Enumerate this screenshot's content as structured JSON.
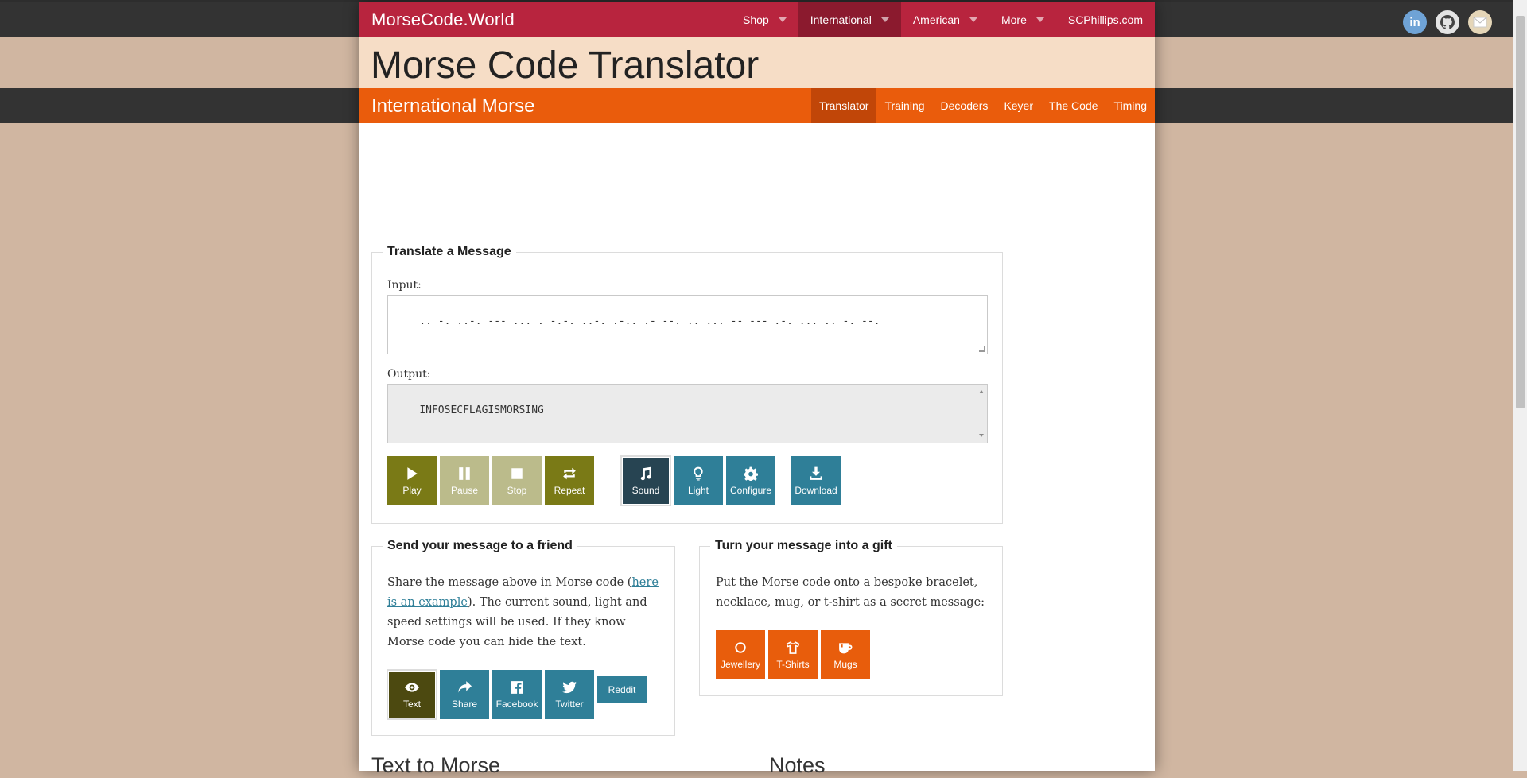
{
  "site": {
    "brand": "MorseCode.World",
    "nav": [
      {
        "label": "Shop",
        "dropdown": true,
        "active": false
      },
      {
        "label": "International",
        "dropdown": true,
        "active": true
      },
      {
        "label": "American",
        "dropdown": true,
        "active": false
      },
      {
        "label": "More",
        "dropdown": true,
        "active": false
      },
      {
        "label": "SCPhillips.com",
        "dropdown": false,
        "active": false
      }
    ],
    "social_icons": [
      "linkedin-icon",
      "github-icon",
      "mail-icon"
    ]
  },
  "page": {
    "title": "Morse Code Translator",
    "subtitle": "International Morse",
    "subnav": [
      "Translator",
      "Training",
      "Decoders",
      "Keyer",
      "The Code",
      "Timing"
    ],
    "active_subnav": "Translator"
  },
  "translate": {
    "legend": "Translate a Message",
    "input_label": "Input:",
    "input_value": ".. -. ..-. --- ... . -.-. ..-. .-.. .- --. .. ... -- --- .-. ... .. -. --.",
    "output_label": "Output:",
    "output_value": "INFOSECFLAGISMORSING",
    "buttons": [
      {
        "label": "Play",
        "icon": "play-icon"
      },
      {
        "label": "Pause",
        "icon": "pause-icon"
      },
      {
        "label": "Stop",
        "icon": "stop-icon"
      },
      {
        "label": "Repeat",
        "icon": "repeat-icon"
      },
      {
        "label": "Sound",
        "icon": "music-icon"
      },
      {
        "label": "Light",
        "icon": "lightbulb-icon"
      },
      {
        "label": "Configure",
        "icon": "gear-icon"
      },
      {
        "label": "Download",
        "icon": "download-icon"
      }
    ]
  },
  "send": {
    "legend": "Send your message to a friend",
    "text_before": "Share the message above in Morse code (",
    "link": "here is an example",
    "text_after": "). The current sound, light and speed settings will be used. If they know Morse code you can hide the text.",
    "buttons": [
      {
        "label": "Text",
        "icon": "eye-icon"
      },
      {
        "label": "Share",
        "icon": "share-icon"
      },
      {
        "label": "Facebook",
        "icon": "facebook-icon"
      },
      {
        "label": "Twitter",
        "icon": "twitter-icon"
      },
      {
        "label": "Reddit"
      }
    ]
  },
  "gift": {
    "legend": "Turn your message into a gift",
    "text": "Put the Morse code onto a bespoke bracelet, necklace, mug, or t-shirt as a secret message:",
    "buttons": [
      {
        "label": "Jewellery",
        "icon": "ring-icon"
      },
      {
        "label": "T-Shirts",
        "icon": "tshirt-icon"
      },
      {
        "label": "Mugs",
        "icon": "mug-icon"
      }
    ]
  },
  "bottom": {
    "left_heading": "Text to Morse",
    "right_heading": "Notes"
  }
}
